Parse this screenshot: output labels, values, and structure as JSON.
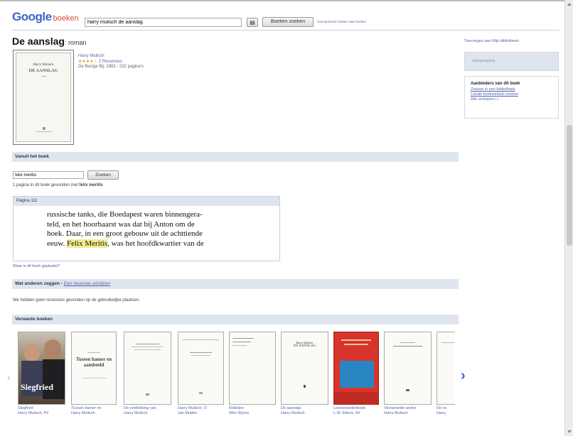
{
  "header": {
    "logo_google": "Google",
    "logo_books": "boeken",
    "search_value": "harry mulisch de aanslag",
    "search_button": "Boeken zoeken",
    "advanced_link": "Geavanceerd zoeken naar boeken"
  },
  "book": {
    "title": "De aanslag",
    "subtitle": ": roman",
    "author": "Harry Mulisch",
    "stars": "★★★★☆",
    "reviews": "2 Recensies",
    "publisher": "De Bezige Bij, 1982 - 232 pagina's",
    "cover_author": "Harry Mulisch",
    "cover_title": "DE AANSLAG"
  },
  "from_book": {
    "header": "Vanuit het boek",
    "search_value": "felix meritis",
    "search_button": "Zoeken",
    "result_prefix": "1 pagina in dit boek gevonden met ",
    "result_term": "felix meritis",
    "page_label": "Pagina 111",
    "excerpt_lines": [
      "russische tanks, die Boedapest waren binnengera-",
      "teld, en het hoorbaarst was dat bij Anton om de",
      "hoek. Daar, in een groot gebouw uit de achttiende"
    ],
    "excerpt_last_pre": "eeuw. ",
    "excerpt_highlight": "Felix Meritis",
    "excerpt_last_post": ", was het hoofdkwartier van de",
    "where_link": "Waar is dit boek geplaatst?"
  },
  "reviews": {
    "header": "Wat anderen zeggen",
    "header_link": "Een recensie schrijven",
    "empty_text": "We hebben geen recensies gevonden op de gebruikelijke plaatsen."
  },
  "related": {
    "header": "Verwante boeken",
    "items": [
      {
        "cap1": "Siegfried",
        "cap2": "Harry Mulisch, Pe"
      },
      {
        "cap1": "Tussen hamer en",
        "cap2": "Harry Mulisch",
        "cover": "Tussen hamer en aambeeld"
      },
      {
        "cap1": "De ontdekking van",
        "cap2": "Harry Mulisch"
      },
      {
        "cap1": "Harry Mulisch, O",
        "cap2": "Jan Mulder"
      },
      {
        "cap1": "Bolletjes",
        "cap2": "Wim Wyers"
      },
      {
        "cap1": "De aanslag",
        "cap2": "Harry Mulisch",
        "cover_a": "Harry Mulisch",
        "cover_b": "DE AANSLAG"
      },
      {
        "cap1": "Leeswoordenboek",
        "cap2": "L.W. Ettens, Mi"
      },
      {
        "cap1": "Verzamelde werke",
        "cap2": "Harry Mulisch"
      },
      {
        "cap1": "De ve",
        "cap2": "Harry"
      }
    ],
    "siegfried_cover": "Siegfried"
  },
  "sidebar": {
    "preview_link": "Toevoegen aan Mijn bibliotheek",
    "gray_button": "Wijzigingslog",
    "buy_title": "Aanbieders van dit boek",
    "buy_links": [
      "Zoeken in een bibliotheek",
      "Lokale boekwinkels zoeken",
      "Alle verkopers »"
    ]
  },
  "colors": {
    "link": "#5566aa",
    "bar": "#dfe5ef",
    "highlight": "#f3ec8c"
  }
}
